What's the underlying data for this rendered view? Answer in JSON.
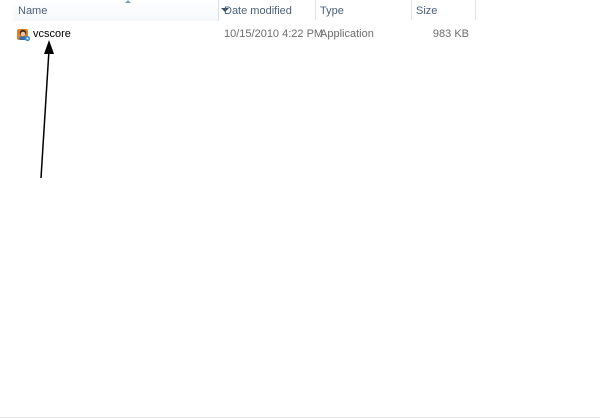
{
  "columns": {
    "name": "Name",
    "date_modified": "Date modified",
    "type": "Type",
    "size": "Size"
  },
  "files": [
    {
      "name": "vcscore",
      "date_modified": "10/15/2010 4:22 PM",
      "type": "Application",
      "size": "983 KB",
      "icon": "application-icon"
    }
  ],
  "colors": {
    "header_text": "#4c607a",
    "annotation_arrow": "#000000"
  }
}
